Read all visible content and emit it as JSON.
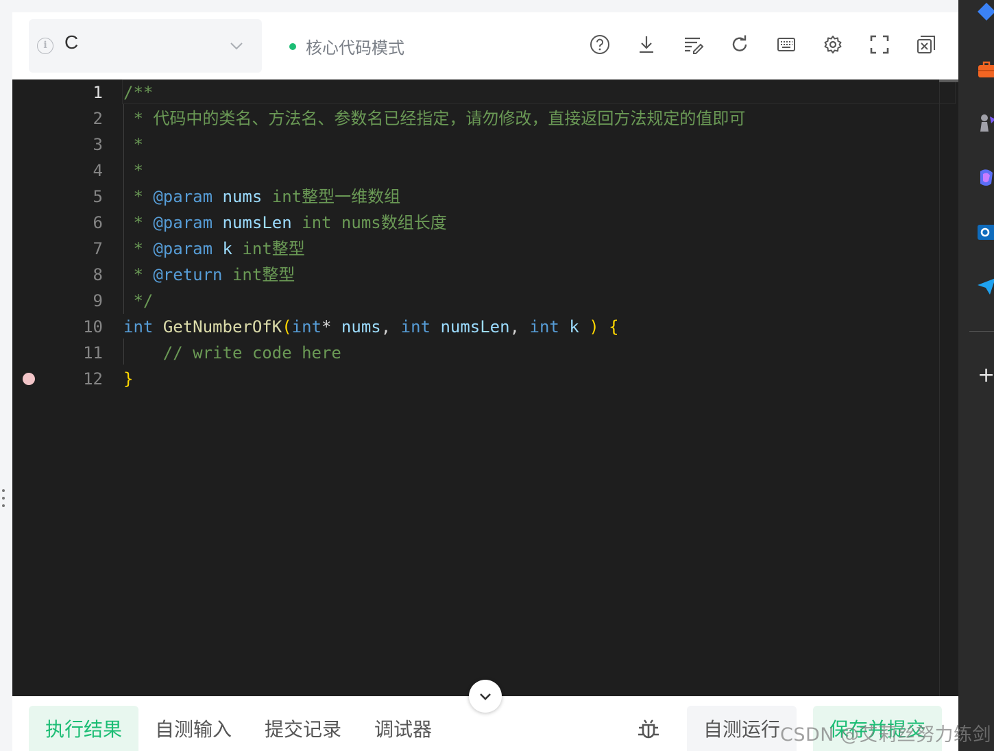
{
  "toolbar": {
    "language": "C",
    "mode_label": "核心代码模式",
    "colors": {
      "accent": "#1bbd74"
    },
    "icons": [
      "help-icon",
      "download-icon",
      "format-icon",
      "reset-icon",
      "keyboard-icon",
      "settings-icon",
      "fullscreen-icon",
      "close-window-icon"
    ]
  },
  "editor": {
    "line_numbers": [
      "1",
      "2",
      "3",
      "4",
      "5",
      "6",
      "7",
      "8",
      "9",
      "10",
      "11",
      "12"
    ],
    "lines": [
      [
        {
          "t": "/**",
          "c": "com"
        }
      ],
      [
        {
          "t": " * 代码中的类名、方法名、参数名已经指定，请勿修改，直接返回方法规定的值即可",
          "c": "com"
        }
      ],
      [
        {
          "t": " *",
          "c": "com"
        }
      ],
      [
        {
          "t": " *",
          "c": "com"
        }
      ],
      [
        {
          "t": " * ",
          "c": "com"
        },
        {
          "t": "@param",
          "c": "tag"
        },
        {
          "t": " ",
          "c": "com"
        },
        {
          "t": "nums",
          "c": "var"
        },
        {
          "t": " int整型一维数组",
          "c": "com"
        }
      ],
      [
        {
          "t": " * ",
          "c": "com"
        },
        {
          "t": "@param",
          "c": "tag"
        },
        {
          "t": " ",
          "c": "com"
        },
        {
          "t": "numsLen",
          "c": "var"
        },
        {
          "t": " int nums数组长度",
          "c": "com"
        }
      ],
      [
        {
          "t": " * ",
          "c": "com"
        },
        {
          "t": "@param",
          "c": "tag"
        },
        {
          "t": " ",
          "c": "com"
        },
        {
          "t": "k",
          "c": "var"
        },
        {
          "t": " int整型",
          "c": "com"
        }
      ],
      [
        {
          "t": " * ",
          "c": "com"
        },
        {
          "t": "@return",
          "c": "tag"
        },
        {
          "t": " int整型",
          "c": "com"
        }
      ],
      [
        {
          "t": " */",
          "c": "com"
        }
      ],
      [
        {
          "t": "int",
          "c": "kw"
        },
        {
          "t": " ",
          "c": "pl"
        },
        {
          "t": "GetNumberOfK",
          "c": "fn"
        },
        {
          "t": "(",
          "c": "br"
        },
        {
          "t": "int",
          "c": "kw"
        },
        {
          "t": "* ",
          "c": "pl"
        },
        {
          "t": "nums",
          "c": "var"
        },
        {
          "t": ", ",
          "c": "pl"
        },
        {
          "t": "int",
          "c": "kw"
        },
        {
          "t": " ",
          "c": "pl"
        },
        {
          "t": "numsLen",
          "c": "var"
        },
        {
          "t": ", ",
          "c": "pl"
        },
        {
          "t": "int",
          "c": "kw"
        },
        {
          "t": " ",
          "c": "pl"
        },
        {
          "t": "k",
          "c": "var"
        },
        {
          "t": " ",
          "c": "pl"
        },
        {
          "t": ")",
          "c": "br"
        },
        {
          "t": " ",
          "c": "pl"
        },
        {
          "t": "{",
          "c": "br"
        }
      ],
      [
        {
          "t": "    // write code here",
          "c": "com"
        }
      ],
      [
        {
          "t": "}",
          "c": "br"
        }
      ]
    ],
    "colors": {
      "comment": "#6a9955",
      "keyword": "#569cd6",
      "variable": "#9cdcfe",
      "function": "#dcdcaa",
      "bracket": "#ffd700",
      "breakpoint": "#f2c5c8"
    }
  },
  "bottom": {
    "tabs": [
      "执行结果",
      "自测输入",
      "提交记录",
      "调试器"
    ],
    "active_tab": "执行结果",
    "run_label": "自测运行",
    "submit_label": "保存并提交",
    "watermark": "CSDN @艾莉丝努力练剑"
  },
  "sidebar": {
    "icons": [
      "diamond-icon",
      "toolbox-icon",
      "chess-icon",
      "copilot-icon",
      "outlook-icon",
      "send-icon",
      "add-icon"
    ],
    "add_label": "+"
  }
}
